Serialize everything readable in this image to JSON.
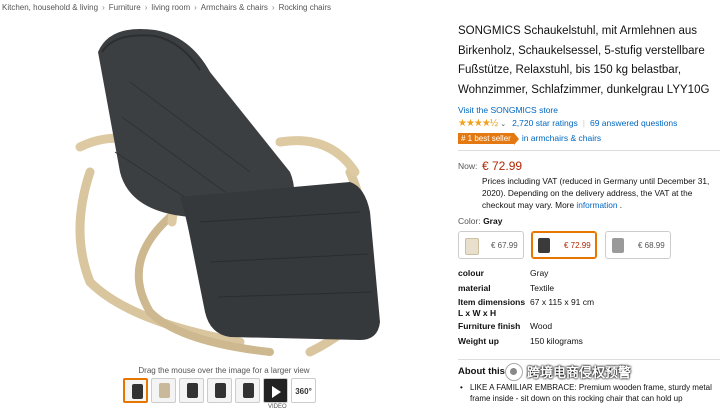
{
  "breadcrumb": [
    "Kitchen, household & living",
    "Furniture",
    "living room",
    "Armchairs & chairs",
    "Rocking chairs"
  ],
  "breadcrumb_sep": "›",
  "gallery": {
    "hint": "Drag the mouse over the image for a larger view",
    "thumb_360": "360°",
    "video_label": "VIDEO"
  },
  "product": {
    "title": "SONGMICS Schaukelstuhl, mit Armlehnen aus Birkenholz, Schaukelsessel, 5-stufig verstellbare Fußstütze, Relaxstuhl, bis 150 kg belastbar, Wohnzimmer, Schlafzimmer, dunkelgrau LYY10G",
    "store_link": "Visit the SONGMICS store",
    "stars": "★★★★½",
    "rating_value": 4.5,
    "ratings_link": "2,720 star ratings",
    "answered_link": "69 answered questions",
    "best_seller_badge": "# 1 best seller",
    "best_seller_category": "in armchairs & chairs"
  },
  "price": {
    "now_label": "Now:",
    "value": "€ 72.99",
    "vat_text": "Prices including VAT (reduced in Germany until December 31, 2020). Depending on the delivery address, the VAT at the checkout may vary. More",
    "info_link": "information",
    "vat_tail": "."
  },
  "color": {
    "label": "Color:",
    "selected": "Gray",
    "options": [
      {
        "price": "€ 67.99",
        "tint": "#e8e0cc"
      },
      {
        "price": "€ 72.99",
        "tint": "#3a3a3a"
      },
      {
        "price": "€ 68.99",
        "tint": "#9a9a9a"
      }
    ]
  },
  "details": [
    {
      "k": "colour",
      "v": "Gray"
    },
    {
      "k": "material",
      "v": "Textile"
    },
    {
      "k": "Item dimensions L x W x H",
      "v": "67 x 115 x 91 cm"
    },
    {
      "k": "Furniture finish",
      "v": "Wood"
    },
    {
      "k": "Weight up",
      "v": "150 kilograms"
    }
  ],
  "about": {
    "heading": "About this a",
    "bullet": "LIKE A FAMILIAR EMBRACE: Premium wooden frame, sturdy metal frame inside - sit down on this rocking chair that can hold up"
  },
  "watermark": "跨境电商侵权预警",
  "accent": "#e77600",
  "link_color": "#0066c0",
  "price_color": "#b12704"
}
